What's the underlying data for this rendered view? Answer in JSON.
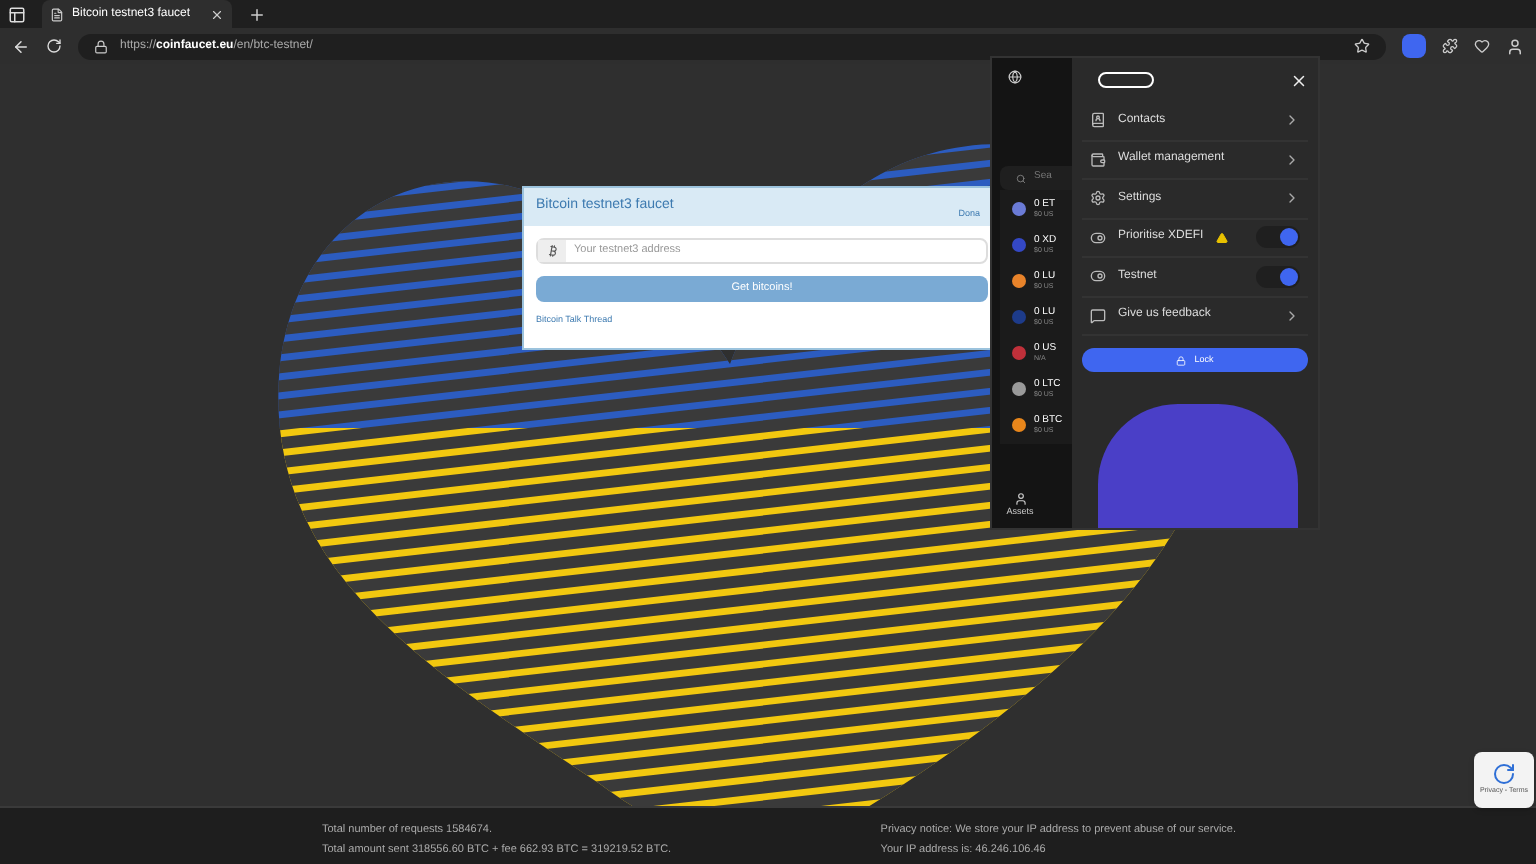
{
  "browser": {
    "tab_title": "Bitcoin testnet3 faucet",
    "url": "https://**coinfaucet.eu**/en/btc-testnet/"
  },
  "faucet": {
    "title": "Bitcoin testnet3 faucet",
    "donate_link": "Dona",
    "address_placeholder": "Your testnet3 address",
    "submit_button": "Get bitcoins!",
    "thread_link": "Bitcoin Talk Thread"
  },
  "wallet": {
    "search_placeholder": "Sea",
    "assets": [
      {
        "amount": "0 ET",
        "value": "$0 US",
        "color": "#6b7bd6"
      },
      {
        "amount": "0 XD",
        "value": "$0 US",
        "color": "#3448c5"
      },
      {
        "amount": "0 LU",
        "value": "$0 US",
        "color": "#e8832a"
      },
      {
        "amount": "0 LU",
        "value": "$0 US",
        "color": "#1d3b8a"
      },
      {
        "amount": "0 US",
        "value": "N/A",
        "color": "#c0303a"
      },
      {
        "amount": "0 LTC",
        "value": "$0 US",
        "color": "#9a9a9a"
      },
      {
        "amount": "0 BTC",
        "value": "$0 US",
        "color": "#e8861b"
      }
    ],
    "nav_label": "Assets",
    "menu": [
      {
        "kind": "link",
        "label": "Contacts"
      },
      {
        "kind": "link",
        "label": "Wallet management"
      },
      {
        "kind": "link",
        "label": "Settings"
      },
      {
        "kind": "toggle",
        "label": "Prioritise XDEFI",
        "warning": true,
        "on": true
      },
      {
        "kind": "toggle",
        "label": "Testnet",
        "warning": false,
        "on": true
      },
      {
        "kind": "link",
        "label": "Give us feedback"
      }
    ],
    "lock_button": "Lock"
  },
  "footer": {
    "left": [
      "Total number of requests 1584674.",
      "Total amount sent 318556.60 BTC + fee 662.93 BTC = 319219.52 BTC."
    ],
    "right": [
      "Privacy notice: We store your IP address to prevent abuse of our service.",
      "Your IP address is: 46.246.106.46"
    ]
  },
  "recaptcha": {
    "text": "Privacy - Terms"
  }
}
